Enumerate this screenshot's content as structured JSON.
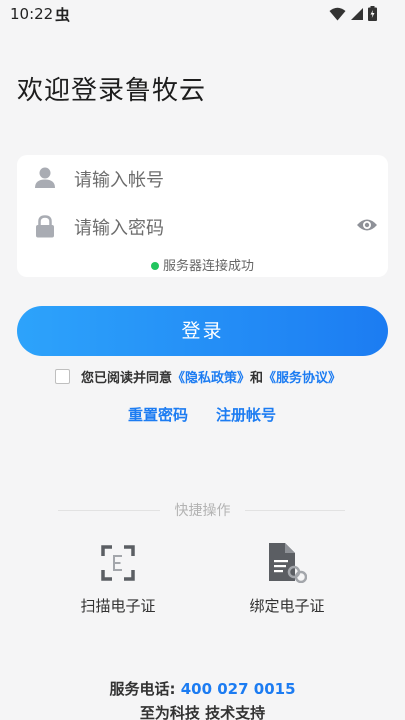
{
  "status_bar": {
    "time": "10:22",
    "extra_glyph": "虫",
    "icons": [
      "wifi-icon",
      "signal-icon",
      "battery-icon"
    ]
  },
  "welcome_title": "欢迎登录鲁牧云",
  "form": {
    "username_placeholder": "请输入帐号",
    "password_placeholder": "请输入密码",
    "server_status": "服务器连接成功",
    "server_status_color": "#22c55e"
  },
  "login_button": "登录",
  "agreement": {
    "prefix": "您已阅读并同意",
    "privacy": "《隐私政策》",
    "and": "和",
    "service": "《服务协议》"
  },
  "links": {
    "reset_password": "重置密码",
    "register": "注册帐号"
  },
  "quick_actions": {
    "title": "快捷操作",
    "scan": "扫描电子证",
    "bind": "绑定电子证"
  },
  "footer": {
    "phone_label": "服务电话:",
    "phone_number": "400 027 0015",
    "support": "至为科技 技术支持"
  },
  "colors": {
    "accent": "#1c7cf2",
    "button_gradient_start": "#2da3fb",
    "background": "#f5f5f6"
  }
}
